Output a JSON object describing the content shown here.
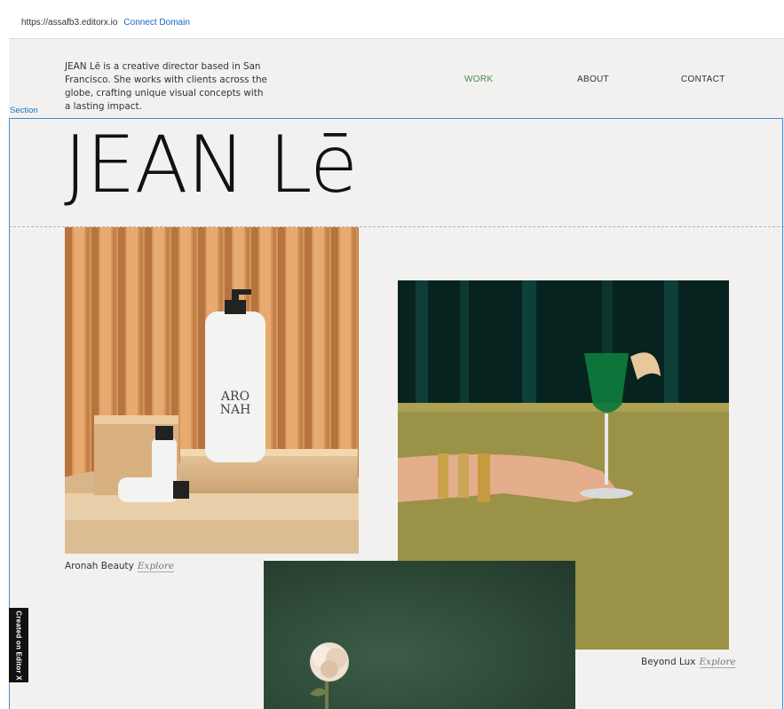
{
  "editor": {
    "url": "https://assafb3.editorx.io",
    "connect_domain": "Connect Domain",
    "section_label": "Section",
    "badge": "Created on Editor X"
  },
  "site": {
    "bio": "JEAN Lē is a creative director based in San Francisco. She works with clients across the globe, crafting unique visual concepts with a lasting impact.",
    "nav": {
      "work": "WORK",
      "about": "ABOUT",
      "contact": "CONTACT"
    },
    "brand": "JEAN Lē",
    "projects": [
      {
        "title": "Aronah Beauty",
        "link": "Explore",
        "bottle_text_1": "ARO",
        "bottle_text_2": "NAH"
      },
      {
        "title": "Beyond Lux",
        "link": "Explore"
      }
    ]
  },
  "colors": {
    "accent_nav": "#4d8a4d",
    "selection_blue": "#3a8de0",
    "canvas_bg": "#f2f1ef"
  }
}
